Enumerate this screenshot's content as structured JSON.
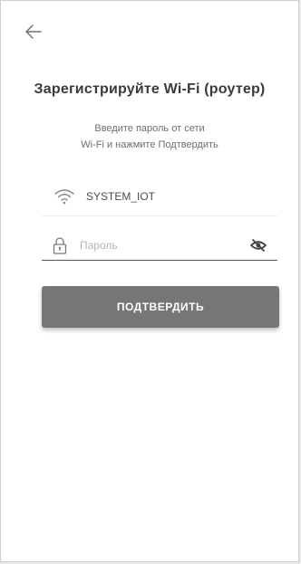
{
  "header": {
    "back_icon": "arrow-left-icon"
  },
  "main": {
    "title": "Зарегистрируйте Wi-Fi (роутер)",
    "subtitle_line1": "Введите пароль от сети",
    "subtitle_line2": "Wi-Fi и нажмите Подтвердить",
    "wifi": {
      "icon": "wifi-icon",
      "ssid": "SYSTEM_IOT"
    },
    "password": {
      "icon": "lock-icon",
      "placeholder": "Пароль",
      "value": "",
      "visibility_icon": "eye-off-icon"
    },
    "confirm_label": "ПОДТВЕРДИТЬ"
  },
  "colors": {
    "button_bg": "#767676",
    "button_text": "#ffffff",
    "title": "#3a3a3a",
    "subtitle": "#6e6e6e"
  }
}
